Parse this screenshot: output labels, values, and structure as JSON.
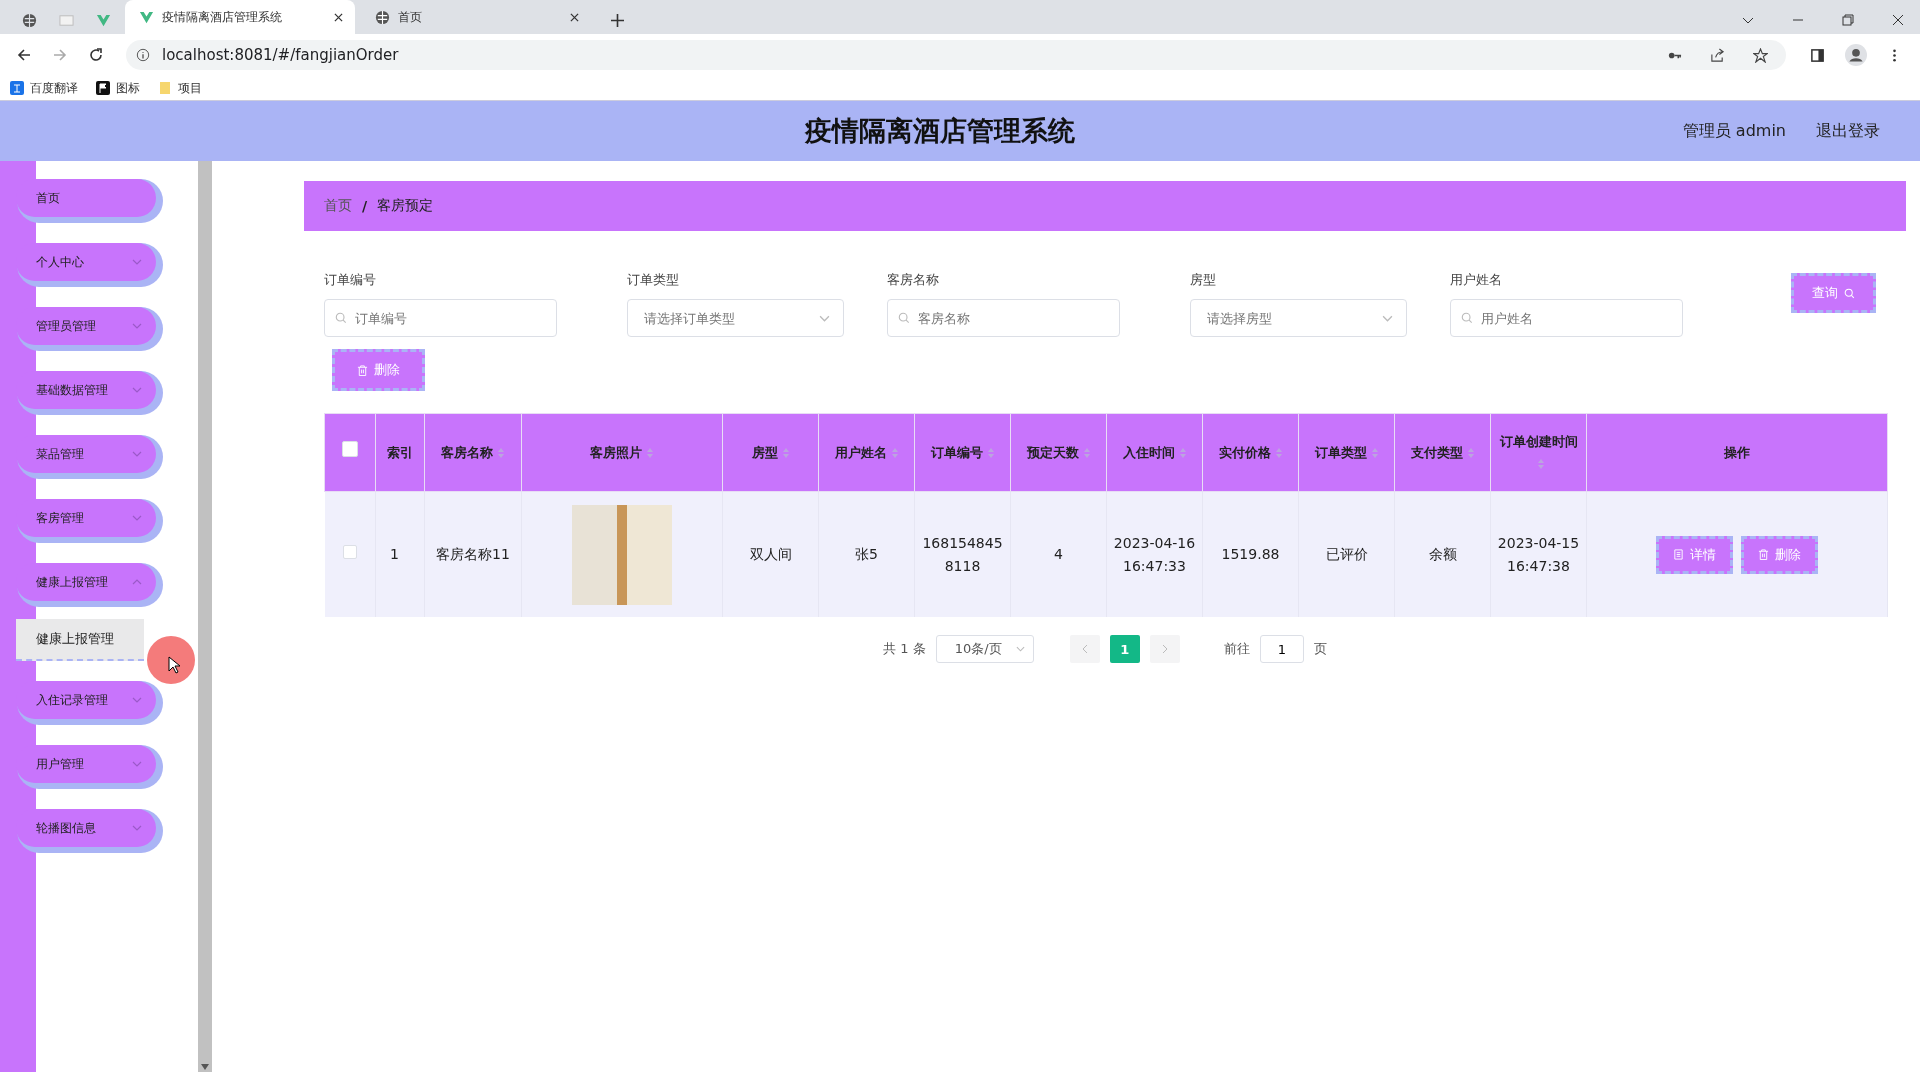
{
  "browser": {
    "tabs": [
      {
        "title": "疫情隔离酒店管理系统",
        "selected": true
      },
      {
        "title": "首页",
        "selected": false
      }
    ],
    "url": "localhost:8081/#/fangjianOrder",
    "bookmarks": [
      "百度翻译",
      "图标",
      "项目"
    ]
  },
  "header": {
    "title": "疫情隔离酒店管理系统",
    "user": "管理员 admin",
    "logout": "退出登录"
  },
  "sidebar": {
    "items": [
      {
        "label": "首页",
        "expandable": false
      },
      {
        "label": "个人中心",
        "expandable": true,
        "expanded": false
      },
      {
        "label": "管理员管理",
        "expandable": true,
        "expanded": false
      },
      {
        "label": "基础数据管理",
        "expandable": true,
        "expanded": false
      },
      {
        "label": "菜品管理",
        "expandable": true,
        "expanded": false
      },
      {
        "label": "客房管理",
        "expandable": true,
        "expanded": false
      },
      {
        "label": "健康上报管理",
        "expandable": true,
        "expanded": true,
        "children": [
          "健康上报管理"
        ]
      },
      {
        "label": "入住记录管理",
        "expandable": true,
        "expanded": false
      },
      {
        "label": "用户管理",
        "expandable": true,
        "expanded": false
      },
      {
        "label": "轮播图信息",
        "expandable": true,
        "expanded": false
      }
    ]
  },
  "breadcrumb": [
    "首页",
    "客房预定"
  ],
  "breadcrumb_separator": "/",
  "filters": [
    {
      "label": "订单编号",
      "kind": "input",
      "placeholder": "订单编号"
    },
    {
      "label": "订单类型",
      "kind": "select",
      "placeholder": "请选择订单类型"
    },
    {
      "label": "客房名称",
      "kind": "input",
      "placeholder": "客房名称"
    },
    {
      "label": "房型",
      "kind": "select",
      "placeholder": "请选择房型"
    },
    {
      "label": "用户姓名",
      "kind": "input",
      "placeholder": "用户姓名"
    }
  ],
  "search_button": "查询",
  "delete_button": "删除",
  "table": {
    "all_checked": false,
    "columns": [
      {
        "label": "索引",
        "sortable": false
      },
      {
        "label": "客房名称",
        "sortable": true
      },
      {
        "label": "客房照片",
        "sortable": true
      },
      {
        "label": "房型",
        "sortable": true
      },
      {
        "label": "用户姓名",
        "sortable": true
      },
      {
        "label": "订单编号",
        "sortable": true
      },
      {
        "label": "预定天数",
        "sortable": true
      },
      {
        "label": "入住时间",
        "sortable": true
      },
      {
        "label": "实付价格",
        "sortable": true
      },
      {
        "label": "订单类型",
        "sortable": true
      },
      {
        "label": "支付类型",
        "sortable": true
      },
      {
        "label": "订单创建时间",
        "sortable": true
      },
      {
        "label": "操作",
        "sortable": false
      }
    ],
    "rows": [
      {
        "checked": false,
        "index": "1",
        "name": "客房名称11",
        "room_type": "双人间",
        "user": "张5",
        "order_no": "1681548458118",
        "days": "4",
        "checkin": "2023-04-16 16:47:33",
        "price": "1519.88",
        "order_type": "已评价",
        "pay_type": "余额",
        "created": "2023-04-15 16:47:38",
        "actions": [
          "详情",
          "删除"
        ]
      }
    ]
  },
  "pagination": {
    "total": "共 1 条",
    "page_size": "10条/页",
    "pages": [
      {
        "label": "1",
        "selected": true
      }
    ],
    "goto": "前往",
    "goto_value": "1",
    "page_unit": "页"
  }
}
